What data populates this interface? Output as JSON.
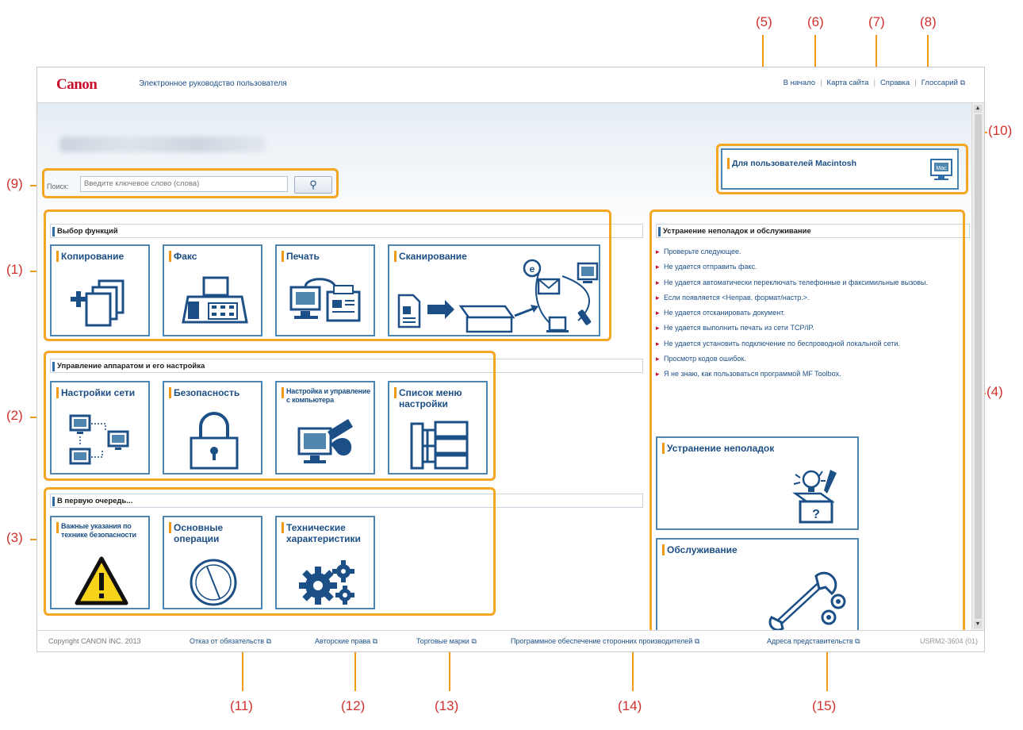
{
  "callouts": {
    "c1": "(1)",
    "c2": "(2)",
    "c3": "(3)",
    "c4": "(4)",
    "c5": "(5)",
    "c6": "(6)",
    "c7": "(7)",
    "c8": "(8)",
    "c9": "(9)",
    "c10": "(10)",
    "c11": "(11)",
    "c12": "(12)",
    "c13": "(13)",
    "c14": "(14)",
    "c15": "(15)"
  },
  "header": {
    "logo": "Canon",
    "title": "Электронное руководство пользователя",
    "links": {
      "home": "В начало",
      "sitemap": "Карта сайта",
      "help": "Справка",
      "glossary": "Глоссарий"
    }
  },
  "search": {
    "label": "Поиск:",
    "placeholder": "Введите ключевое слово (слова)",
    "button_icon": "search-wand-icon"
  },
  "mac": {
    "label": "Для пользователей Macintosh",
    "icon_text": "Mac"
  },
  "sections": {
    "functions": {
      "title": "Выбор функций",
      "tiles": [
        "Копирование",
        "Факс",
        "Печать",
        "Сканирование"
      ]
    },
    "management": {
      "title": "Управление аппаратом и его настройка",
      "tiles": [
        "Настройки сети",
        "Безопасность",
        "Настройка и управление с компьютера",
        "Список меню настройки"
      ]
    },
    "first": {
      "title": "В первую очередь...",
      "tiles": [
        "Важные указания по технике безопасности",
        "Основные операции",
        "Технические характеристики"
      ]
    },
    "troubleshooting": {
      "title": "Устранение неполадок и обслуживание",
      "items": [
        "Проверьте следующее.",
        "Не удается отправить факс.",
        "Не удается автоматически переключать телефонные и факсимильные вызовы.",
        "Если появляется <Неправ. формат/настр.>.",
        "Не удается отсканировать документ.",
        "Не удается выполнить печать из сети TCP/IP.",
        "Не удается установить подключение по беспроводной локальной сети.",
        "Просмотр кодов ошибок.",
        "Я не знаю, как пользоваться программой MF Toolbox."
      ],
      "tiles": [
        "Устранение неполадок",
        "Обслуживание"
      ]
    }
  },
  "footer": {
    "copyright": "Copyright CANON INC. 2013",
    "links": [
      "Отказ от обязательств",
      "Авторские права",
      "Торговые марки",
      "Программное обеспечение сторонних производителей",
      "Адреса представительств"
    ],
    "code": "USRM2-3604 (01)"
  },
  "colors": {
    "accent_orange": "#f5a623",
    "canon_red": "#c8102e",
    "link_blue": "#1c4f86",
    "tile_border": "#4e86b0"
  }
}
